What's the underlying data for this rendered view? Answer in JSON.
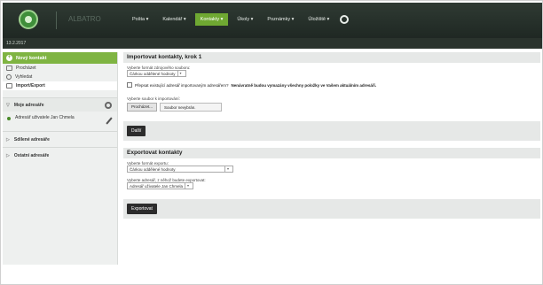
{
  "header": {
    "brand": "ALBATRO",
    "session": "13.2.2017",
    "nav": [
      {
        "label": "Pošta ▾",
        "active": false
      },
      {
        "label": "Kalendář ▾",
        "active": false
      },
      {
        "label": "Kontakty ▾",
        "active": true
      },
      {
        "label": "Úkoly ▾",
        "active": false
      },
      {
        "label": "Poznámky ▾",
        "active": false
      },
      {
        "label": "Úložiště ▾",
        "active": false
      }
    ],
    "settings_icon": "gear-icon"
  },
  "sidebar": {
    "new_contact": "Nový kontakt",
    "links": [
      {
        "label": "Procházet",
        "icon": "browse-icon"
      },
      {
        "label": "Vyhledat",
        "icon": "search-icon"
      },
      {
        "label": "Import/Export",
        "icon": "import-export-icon"
      }
    ],
    "my_books_title": "Moje adresáře",
    "my_book_item": "Adresář uživatele Jan Chmela",
    "shared_books_title": "Sdílené adresáře",
    "other_books_title": "Ostatní adresáře"
  },
  "import": {
    "title": "Importovat kontakty, krok 1",
    "format_label": "Vyberte formát zdrojového souboru:",
    "format_value": "Čárkou oddělené hodnoty",
    "replace_text": "Přepsat existující adresář importovaným adresářem?",
    "replace_warning": "Nenávratně budou vymazány všechny položky ve Vašem aktuálním adresáři.",
    "file_label": "Vyberte soubor k importování:",
    "browse_button": "Procházet...",
    "file_status": "Soubor nevybrán.",
    "next_button": "Další"
  },
  "export": {
    "title": "Exportovat kontakty",
    "format_label": "Vyberte formát exportu:",
    "format_value": "Čárkou oddělené hodnoty",
    "book_label": "Vyberte adresář, z něhož budete exportovat:",
    "book_value": "Adresář uživatele Jan Chmela",
    "export_button": "Exportovat"
  }
}
